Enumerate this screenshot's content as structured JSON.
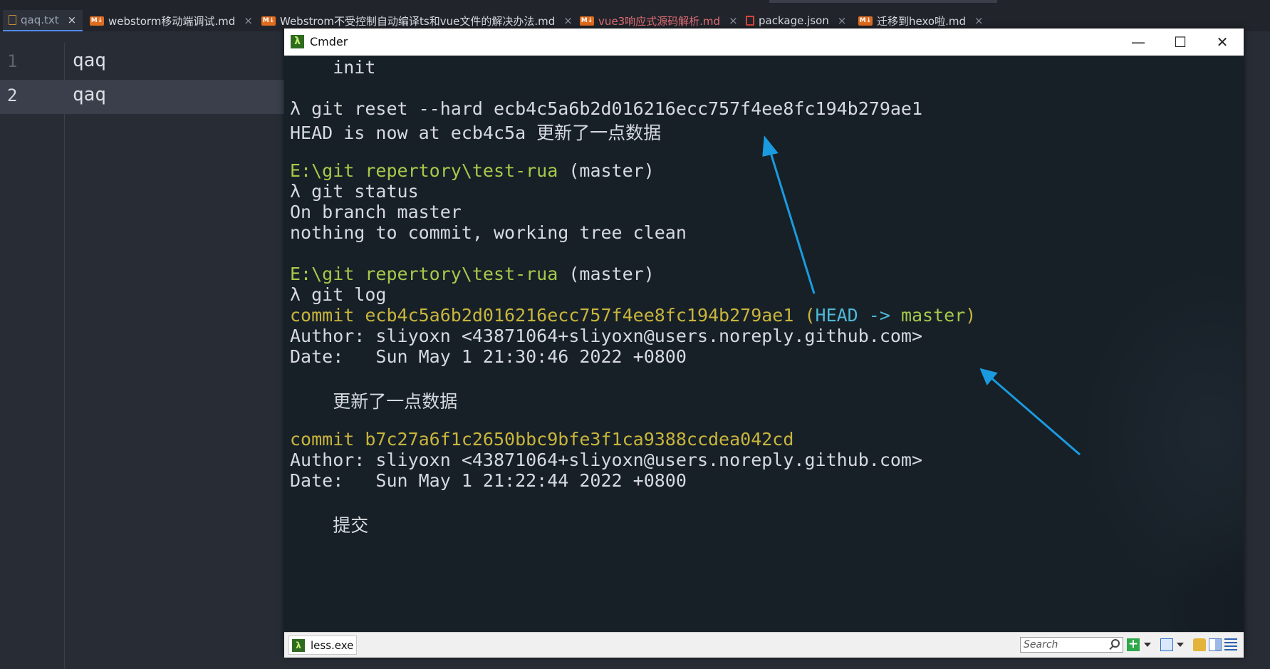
{
  "editor": {
    "tabs": [
      {
        "label": "qaq.txt",
        "icon": "txt-file-icon",
        "active": true
      },
      {
        "label": "webstorm移动端调试.md",
        "icon": "markdown-file-icon"
      },
      {
        "label": "Webstrom不受控制自动编译ts和vue文件的解决办法.md",
        "icon": "markdown-file-icon"
      },
      {
        "label": "vue3响应式源码解析.md",
        "icon": "markdown-file-icon",
        "color": "#e06c75"
      },
      {
        "label": "package.json",
        "icon": "json-file-icon"
      },
      {
        "label": "迁移到hexo啦.md",
        "icon": "markdown-file-icon"
      }
    ],
    "close_glyph": "×",
    "lines": [
      {
        "number": "1",
        "text": "qaq"
      },
      {
        "number": "2",
        "text": "qaq"
      }
    ]
  },
  "cmder": {
    "title": "Cmder",
    "window_buttons": {
      "minimize": "—",
      "maximize": "☐",
      "close": "✕"
    },
    "terminal_lines": [
      {
        "text": "    init"
      },
      {
        "text": ""
      },
      {
        "text": "λ git reset --hard ecb4c5a6b2d016216ecc757f4ee8fc194b279ae1"
      },
      {
        "text": "HEAD is now at ecb4c5a 更新了一点数据"
      },
      {
        "text": ""
      },
      {
        "path": "E:\\git repertory\\test-rua",
        "branch": " (master)"
      },
      {
        "text": "λ git status"
      },
      {
        "text": "On branch master"
      },
      {
        "text": "nothing to commit, working tree clean"
      },
      {
        "text": ""
      },
      {
        "path": "E:\\git repertory\\test-rua",
        "branch": " (master)"
      },
      {
        "text": "λ git log"
      },
      {
        "commit": "commit ecb4c5a6b2d016216ecc757f4ee8fc194b279ae1",
        "ref_open": " (",
        "head": "HEAD ->",
        "master": " master",
        "ref_close": ")"
      },
      {
        "text": "Author: sliyoxn <43871064+sliyoxn@users.noreply.github.com>"
      },
      {
        "text": "Date:   Sun May 1 21:30:46 2022 +0800"
      },
      {
        "text": ""
      },
      {
        "text": "    更新了一点数据"
      },
      {
        "text": ""
      },
      {
        "commit": "commit b7c27a6f1c2650bbc9bfe3f1ca9388ccdea042cd"
      },
      {
        "text": "Author: sliyoxn <43871064+sliyoxn@users.noreply.github.com>"
      },
      {
        "text": "Date:   Sun May 1 21:22:44 2022 +0800"
      },
      {
        "text": ""
      },
      {
        "text": "    提交"
      }
    ],
    "status_bar": {
      "tab_label": "less.exe",
      "search_placeholder": "Search"
    }
  },
  "colors": {
    "path_green": "#a6c94a",
    "commit_yellow": "#c8b53c",
    "head_cyan": "#4fb8d7",
    "arrow_blue": "#1a9be0"
  }
}
